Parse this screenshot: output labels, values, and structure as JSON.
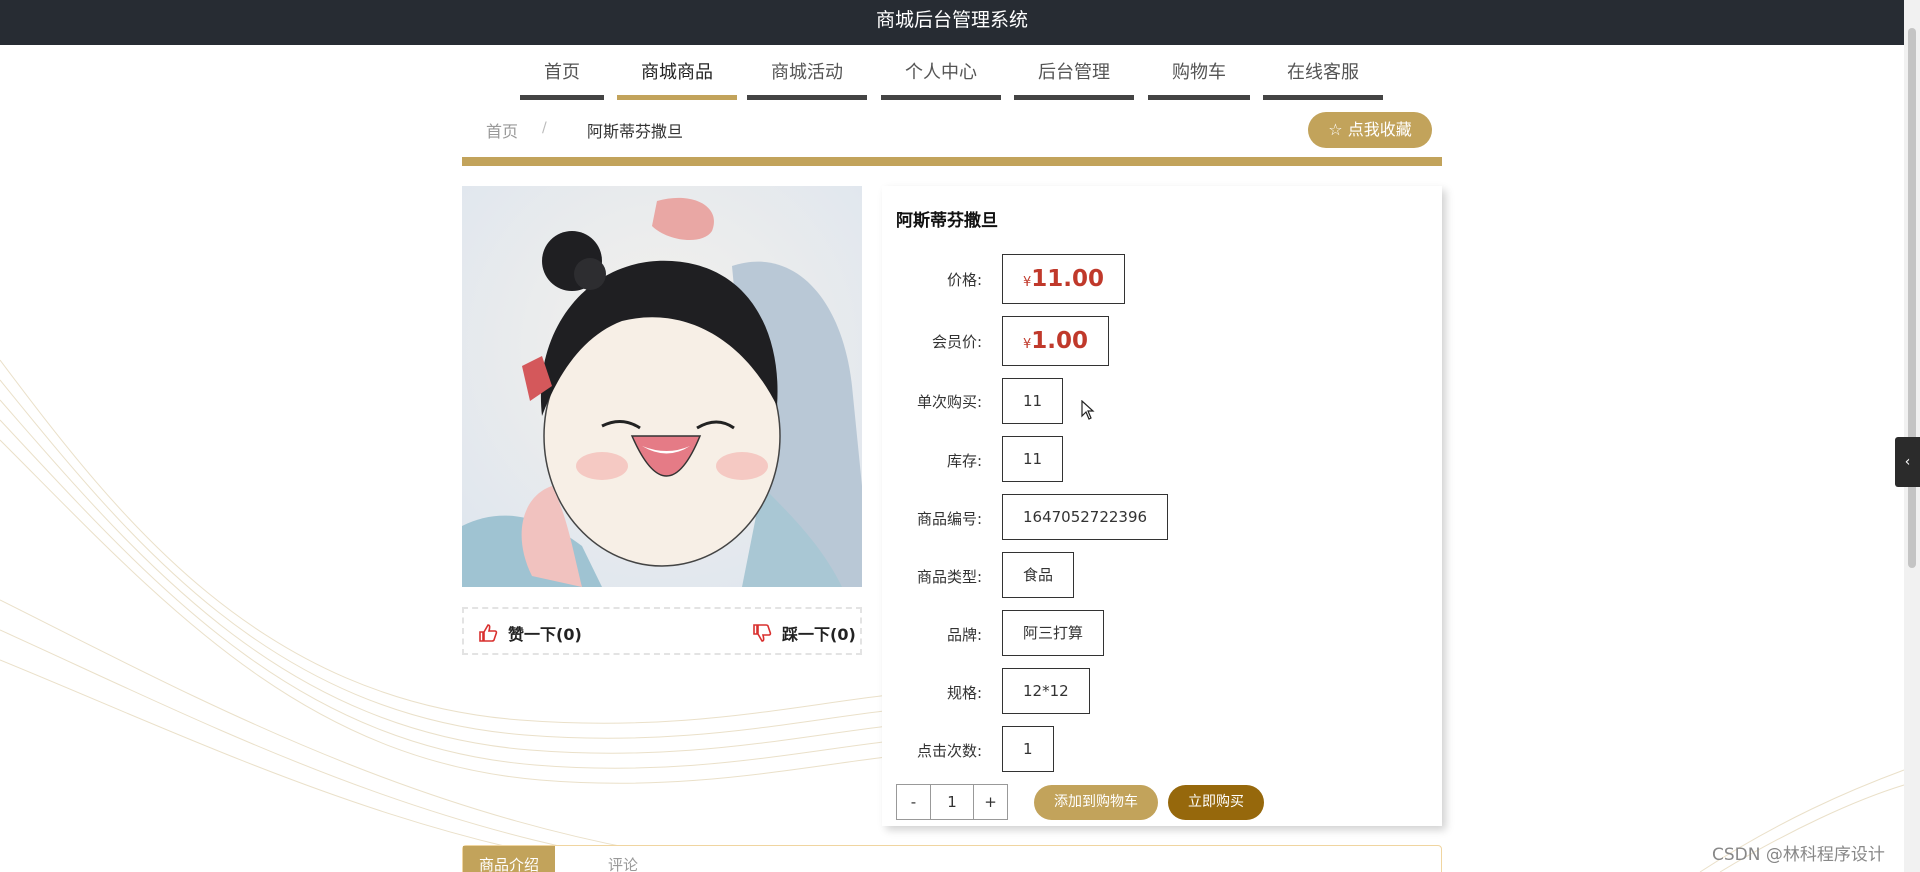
{
  "header": {
    "title": "商城后台管理系统"
  },
  "nav": {
    "items": [
      {
        "label": "首页",
        "active": false
      },
      {
        "label": "商城商品",
        "active": true
      },
      {
        "label": "商城活动",
        "active": false
      },
      {
        "label": "个人中心",
        "active": false
      },
      {
        "label": "后台管理",
        "active": false
      },
      {
        "label": "购物车",
        "active": false
      },
      {
        "label": "在线客服",
        "active": false
      }
    ]
  },
  "breadcrumb": {
    "home": "首页",
    "separator": "/",
    "current": "阿斯蒂芬撒旦"
  },
  "favorite_button": {
    "label": "☆ 点我收藏"
  },
  "product": {
    "title": "阿斯蒂芬撒旦",
    "image_icon": "product-illustration",
    "price": {
      "label": "价格:",
      "symbol": "¥",
      "value": "11.00"
    },
    "member_price": {
      "label": "会员价:",
      "symbol": "¥",
      "value": "1.00"
    },
    "single_purchase": {
      "label": "单次购买:",
      "value": "11"
    },
    "stock": {
      "label": "库存:",
      "value": "11"
    },
    "product_code": {
      "label": "商品编号:",
      "value": "1647052722396"
    },
    "product_type": {
      "label": "商品类型:",
      "value": "食品"
    },
    "brand": {
      "label": "品牌:",
      "value": "阿三打算"
    },
    "spec": {
      "label": "规格:",
      "value": "12*12"
    },
    "clicks": {
      "label": "点击次数:",
      "value": "1"
    }
  },
  "votes": {
    "like": {
      "label": "赞一下(0)",
      "icon": "thumbs-up-icon"
    },
    "dislike": {
      "label": "踩一下(0)",
      "icon": "thumbs-down-icon"
    }
  },
  "quantity": {
    "minus": "-",
    "value": "1",
    "plus": "+"
  },
  "actions": {
    "add_to_cart": "添加到购物车",
    "buy_now": "立即购买"
  },
  "tabs": [
    {
      "label": "商品介绍",
      "active": true
    },
    {
      "label": "评论",
      "active": false
    }
  ],
  "side_tab": {
    "icon": "chevron-left-icon",
    "glyph": "‹"
  },
  "watermark": {
    "text": "CSDN @林科程序设计"
  },
  "colors": {
    "accent": "#c2a35b",
    "dark_accent": "#96680c",
    "header_bg": "#272c33",
    "price": "#c0392b"
  }
}
